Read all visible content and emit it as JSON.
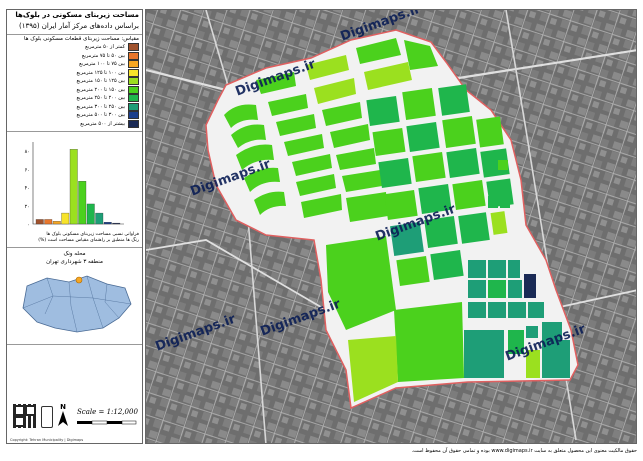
{
  "title": {
    "line1": "مساحت زیربنای مسکونی در بلوک‌ها",
    "line2": "براساس داده‌های مرکز آمار ایران (۱۳۹۵)"
  },
  "legend": {
    "heading": "مقیاس: مساحت زیربنای قطعات مسکونی بلوک ها",
    "items": [
      {
        "label": "کمتر از ۵۰ مترمربع",
        "color": "#a0522d"
      },
      {
        "label": "بین ۵۰ تا ۷۵ مترمربع",
        "color": "#e8762b"
      },
      {
        "label": "بین ۷۵ تا ۱۰۰ مترمربع",
        "color": "#f5a623"
      },
      {
        "label": "بین ۱۰۰ تا ۱۲۵ مترمربع",
        "color": "#f7e32a"
      },
      {
        "label": "بین ۱۲۵ تا ۱۵۰ مترمربع",
        "color": "#9be01f"
      },
      {
        "label": "بین ۱۵۰ تا ۲۰۰ مترمربع",
        "color": "#4bd11d"
      },
      {
        "label": "بین ۲۰۰ تا ۲۵۰ مترمربع",
        "color": "#1fb64c"
      },
      {
        "label": "بین ۲۵۰ تا ۳۰۰ مترمربع",
        "color": "#1e9e77"
      },
      {
        "label": "بین ۳۰۰ تا ۵۰۰ مترمربع",
        "color": "#1c3f8c"
      },
      {
        "label": "بیشتر از ۵۰۰ مترمربع",
        "color": "#1a2a55"
      }
    ]
  },
  "histogram": {
    "y_ticks": [
      "۰",
      "۲۰",
      "۴۰",
      "۶۰",
      "۸۰"
    ],
    "values": [
      5,
      5,
      3,
      12,
      82,
      47,
      22,
      12,
      2,
      1
    ],
    "caption_line1": "فراوانی نسبی مساحت زیربنای مسکونی بلوک ها",
    "caption_line2": "رنگ ها منطبق بر راهنمای مقیاس مساحت است (%)"
  },
  "region": {
    "line1": "محله ونک",
    "line2": "منطقه ۳ شهرداری تهران"
  },
  "scale": "Scale = 1:12,000",
  "north_label": "N",
  "credit": "Copyright: Tehran Municipality | Digimaps",
  "footer": "حقوق مالکیت معنوی این محصول متعلق به سایت www.digimaps.ir بوده و تمامی حقوق آن محفوظ است.",
  "watermark": "Digimaps.ir"
}
